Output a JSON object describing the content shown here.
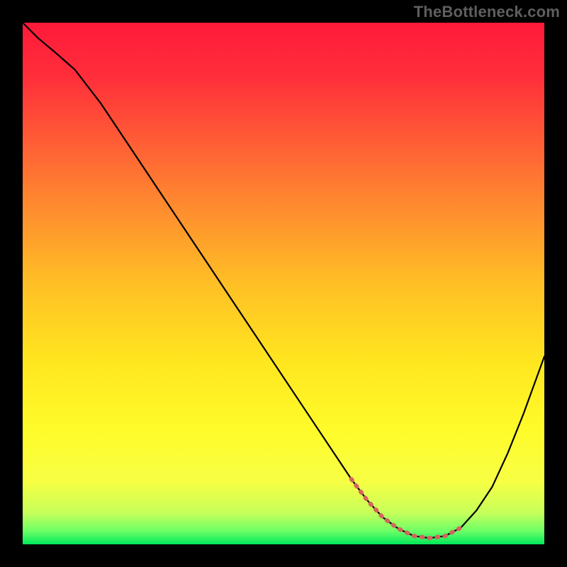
{
  "watermark": "TheBottleneck.com",
  "chart_data": {
    "type": "line",
    "title": "",
    "xlabel": "",
    "ylabel": "",
    "xlim": [
      0,
      100
    ],
    "ylim": [
      0,
      100
    ],
    "background_gradient": {
      "stops": [
        {
          "offset": 0.0,
          "color": "#ff1a3a"
        },
        {
          "offset": 0.1,
          "color": "#ff2d3a"
        },
        {
          "offset": 0.22,
          "color": "#ff5a36"
        },
        {
          "offset": 0.35,
          "color": "#ff8a2f"
        },
        {
          "offset": 0.5,
          "color": "#ffbf25"
        },
        {
          "offset": 0.65,
          "color": "#ffe61f"
        },
        {
          "offset": 0.78,
          "color": "#fffb2a"
        },
        {
          "offset": 0.88,
          "color": "#f7ff44"
        },
        {
          "offset": 0.94,
          "color": "#c6ff5a"
        },
        {
          "offset": 0.975,
          "color": "#6bff66"
        },
        {
          "offset": 1.0,
          "color": "#00e85a"
        }
      ]
    },
    "series": [
      {
        "name": "bottleneck-curve",
        "stroke": "#000000",
        "stroke_width": 2.2,
        "x": [
          0,
          3,
          6,
          10,
          15,
          20,
          25,
          30,
          35,
          40,
          45,
          50,
          55,
          60,
          63,
          66,
          69,
          72,
          75,
          78,
          81,
          84,
          87,
          90,
          93,
          96,
          100
        ],
        "y": [
          100,
          97,
          94.5,
          91,
          84.5,
          77,
          69.5,
          62,
          54.5,
          47,
          39.5,
          32,
          24.5,
          17,
          12.5,
          8.5,
          5.2,
          3,
          1.6,
          1.2,
          1.6,
          3.2,
          6.5,
          11,
          17.5,
          25,
          36
        ]
      }
    ],
    "highlight": {
      "name": "minimum-band",
      "stroke": "#d4645f",
      "stroke_width": 6,
      "linecap": "round",
      "dash": [
        2,
        9
      ],
      "x": [
        63,
        66,
        69,
        72,
        75,
        78,
        81,
        84
      ],
      "y": [
        12.5,
        8.5,
        5.2,
        3,
        1.6,
        1.2,
        1.6,
        3.2
      ]
    }
  }
}
